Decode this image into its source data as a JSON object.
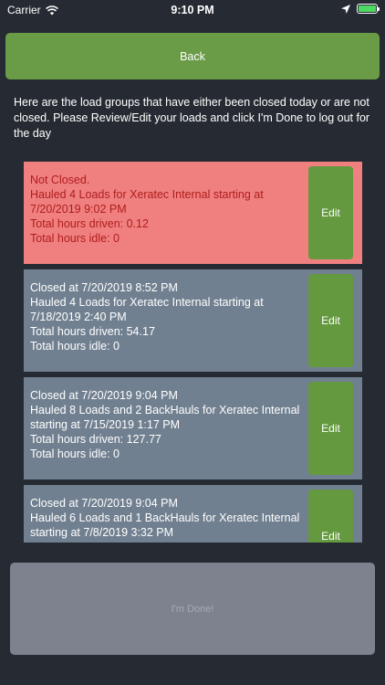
{
  "status_bar": {
    "carrier": "Carrier",
    "time": "9:10 PM",
    "icons": [
      "wifi-icon",
      "location-arrow-icon",
      "battery-icon"
    ]
  },
  "back_button": {
    "label": "Back"
  },
  "instructions": "Here are the load groups that have either been closed today or are not closed.  Please Review/Edit your loads and click I'm Done to log out for the day",
  "load_groups": [
    {
      "status": "Not Closed.",
      "summary": "Hauled 4 Loads for Xeratec Internal starting at 7/20/2019 9:02 PM",
      "hours_driven": "Total hours driven: 0.12",
      "hours_idle": "Total hours idle: 0",
      "edit_label": "Edit",
      "color": "#f08080"
    },
    {
      "status": "Closed at 7/20/2019 8:52 PM",
      "summary": "Hauled 4 Loads for Xeratec Internal starting at 7/18/2019 2:40 PM",
      "hours_driven": "Total hours driven: 54.17",
      "hours_idle": "Total hours idle: 0",
      "edit_label": "Edit",
      "color": "#718090"
    },
    {
      "status": "Closed at 7/20/2019 9:04 PM",
      "summary": "Hauled 8 Loads and 2 BackHauls for Xeratec Internal starting at 7/15/2019 1:17 PM",
      "hours_driven": "Total hours driven: 127.77",
      "hours_idle": "Total hours idle: 0",
      "edit_label": "Edit",
      "color": "#718090"
    },
    {
      "status": "Closed at 7/20/2019 9:04 PM",
      "summary": "Hauled 6 Loads and 1 BackHauls for Xeratec Internal starting at 7/8/2019 3:32 PM",
      "hours_driven": "",
      "hours_idle": "",
      "edit_label": "Edit",
      "color": "#718090"
    }
  ],
  "done_button": {
    "label": "I'm Done!"
  },
  "colors": {
    "background": "#262b33",
    "accent_green": "#6a9b46",
    "not_closed_red": "#f08080",
    "closed_gray": "#718090",
    "disabled_button": "#7d828e"
  }
}
